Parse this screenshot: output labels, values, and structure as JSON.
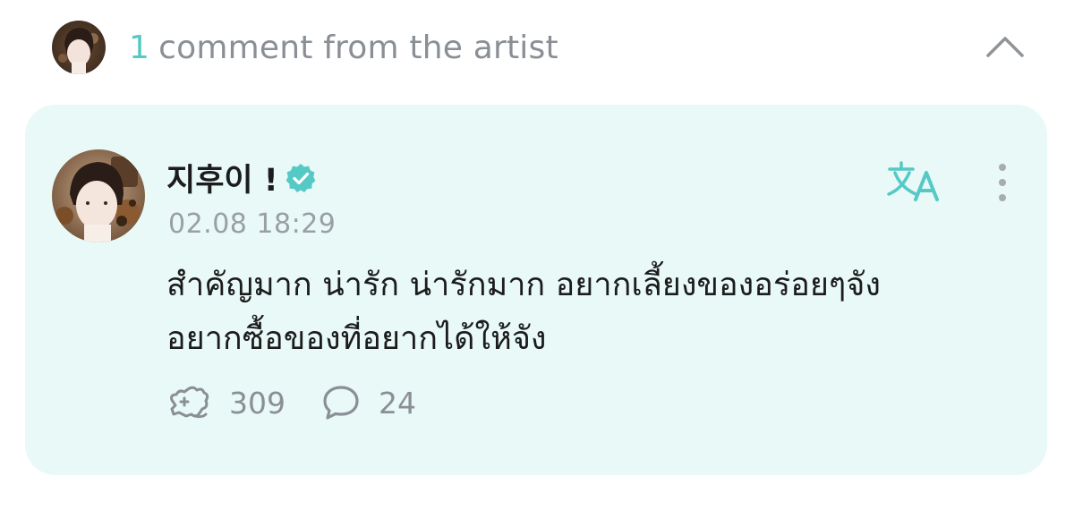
{
  "header": {
    "count": "1",
    "label": "comment from the artist",
    "collapse_icon": "chevron-up-icon"
  },
  "comment": {
    "author": "지후이 !",
    "verified_icon": "verified-badge-icon",
    "timestamp": "02.08 18:29",
    "text_lines": [
      "สำคัญมาก น่ารัก น่ารักมาก อยากเลี้ยงของอร่อยๆจัง",
      "อยากซื้อของที่อยากได้ให้จัง"
    ],
    "translate_icon": "translate-icon",
    "more_icon": "more-vertical-icon",
    "likes": "309",
    "replies": "24"
  },
  "colors": {
    "accent": "#55c9c5",
    "card_background": "#e8f9f7",
    "muted_text": "#8a8f95"
  }
}
